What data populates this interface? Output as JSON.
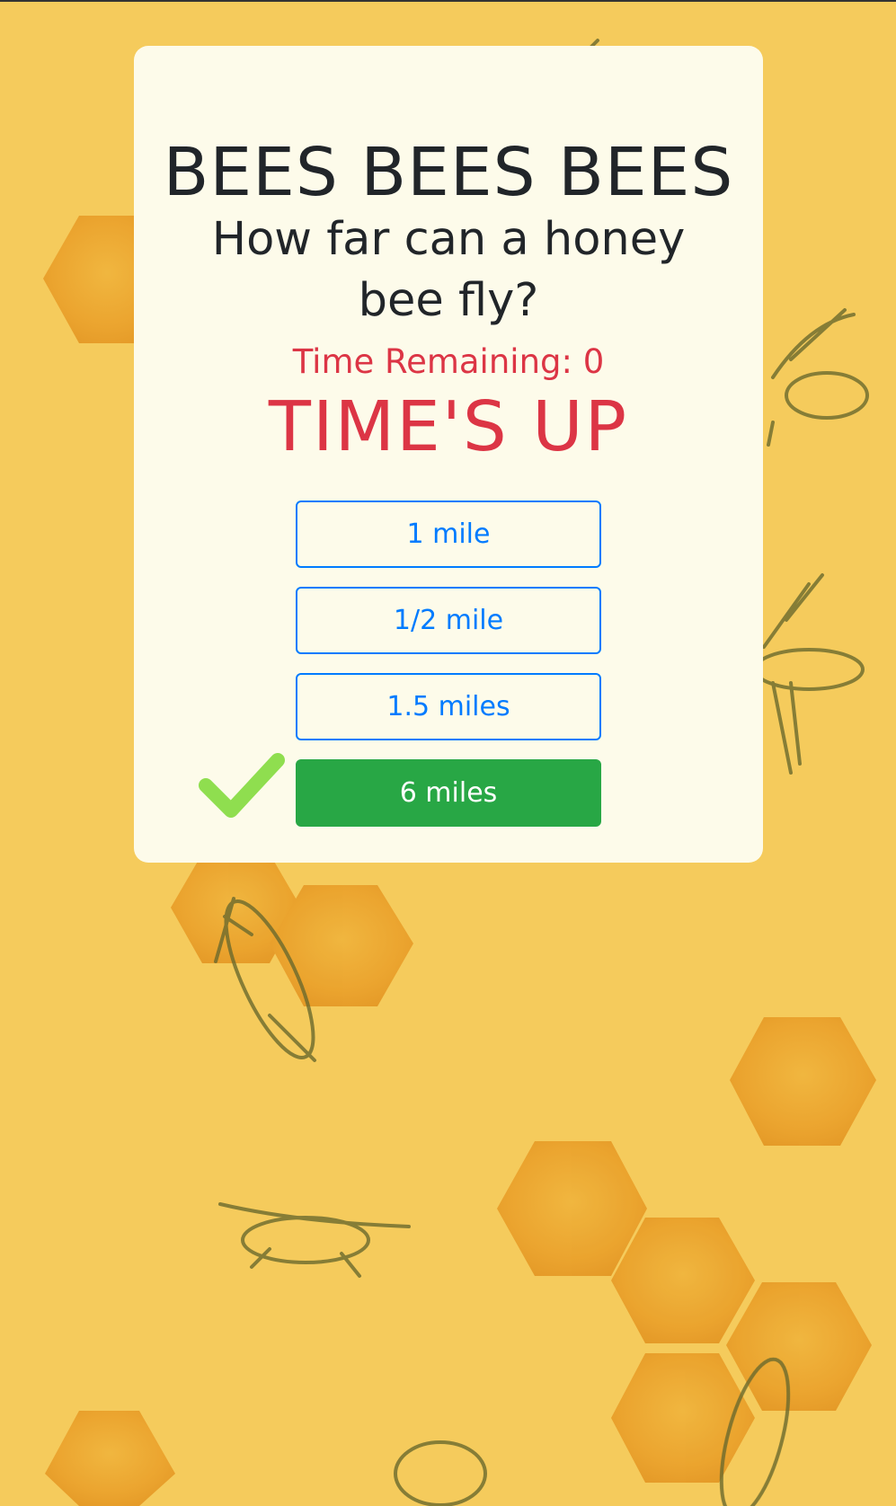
{
  "game": {
    "title": "BEES BEES BEES",
    "question": "How far can a honey bee fly?",
    "timer_text": "Time Remaining: 0",
    "status_text": "TIME'S UP",
    "answers": [
      {
        "label": "1 mile",
        "correct": false
      },
      {
        "label": "1/2 mile",
        "correct": false
      },
      {
        "label": "1.5 miles",
        "correct": false
      },
      {
        "label": "6 miles",
        "correct": true
      }
    ],
    "correct_indicator_icon": "checkmark-icon"
  },
  "colors": {
    "background": "#f5cb5c",
    "card": "#fdfbea",
    "text": "#212529",
    "danger": "#dc3545",
    "outline_button": "#007bff",
    "correct_button": "#28a745",
    "checkmark": "#8fde4f",
    "honeycomb": "#e9a12a"
  }
}
